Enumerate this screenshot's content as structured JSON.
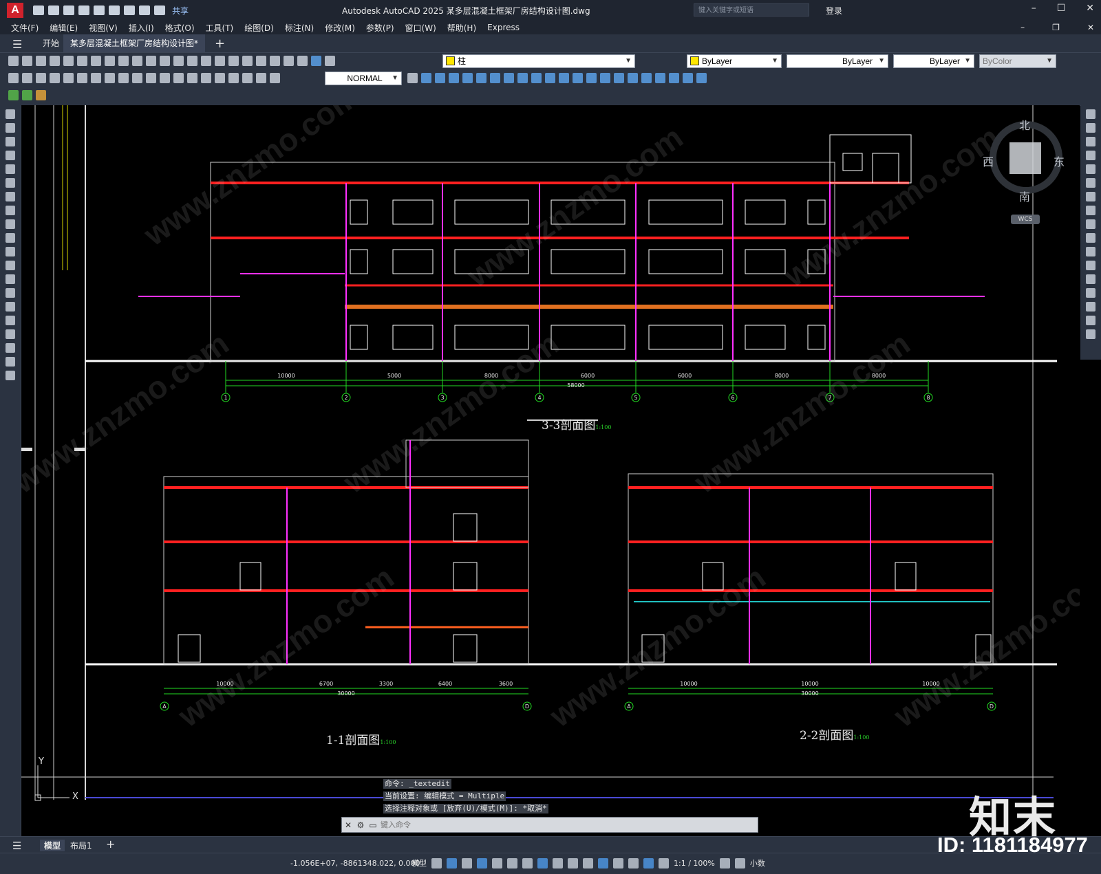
{
  "app": {
    "logo": "A",
    "title": "Autodesk AutoCAD 2025    某多层混凝土框架厂房结构设计图.dwg",
    "share_label": "共享",
    "search_placeholder": "键入关键字或短语",
    "login_label": "登录"
  },
  "menu": [
    "文件(F)",
    "编辑(E)",
    "视图(V)",
    "插入(I)",
    "格式(O)",
    "工具(T)",
    "绘图(D)",
    "标注(N)",
    "修改(M)",
    "参数(P)",
    "窗口(W)",
    "帮助(H)",
    "Express"
  ],
  "tabs": {
    "start": "开始",
    "document": "某多层混凝土框架厂房结构设计图*"
  },
  "toolbar": {
    "layer_name": "柱",
    "color": "ByLayer",
    "linetype": "ByLayer",
    "lineweight": "ByLayer",
    "plotstyle": "ByColor",
    "dimstyle": "NORMAL"
  },
  "compass": {
    "north": "北",
    "south": "南",
    "west": "西",
    "east": "东",
    "wcs": "WCS"
  },
  "drawing": {
    "section_33": {
      "title": "3-3剖面图",
      "scale": "1:100",
      "dims": [
        "10000",
        "5000",
        "8000",
        "6000",
        "6000",
        "8000",
        "8000"
      ],
      "total": "58000",
      "axes": [
        "1",
        "2",
        "3",
        "4",
        "5",
        "6",
        "7",
        "8"
      ]
    },
    "section_11": {
      "title": "1-1剖面图",
      "scale": "1:100",
      "dims": [
        "10000",
        "6700",
        "3300",
        "6400",
        "3600"
      ],
      "total": "30000",
      "axes": [
        "A",
        "D"
      ]
    },
    "section_22": {
      "title": "2-2剖面图",
      "scale": "1:100",
      "dims": [
        "10000",
        "10000",
        "10000"
      ],
      "total": "30000",
      "axes": [
        "A",
        "D"
      ]
    }
  },
  "command": {
    "history": [
      "命令: _textedit",
      "当前设置: 编辑模式 = Multiple",
      "选择注释对象或 [放弃(U)/模式(M)]: *取消*"
    ],
    "placeholder": "键入命令"
  },
  "layouts": {
    "model": "模型",
    "layout1": "布局1"
  },
  "status": {
    "coords": "-1.056E+07, -8861348.022, 0.000",
    "model": "模型",
    "scale": "1:1 / 100%",
    "units": "小数"
  },
  "watermark": {
    "brand": "知末",
    "id": "ID: 1181184977",
    "site": "www.znzmo.com"
  }
}
